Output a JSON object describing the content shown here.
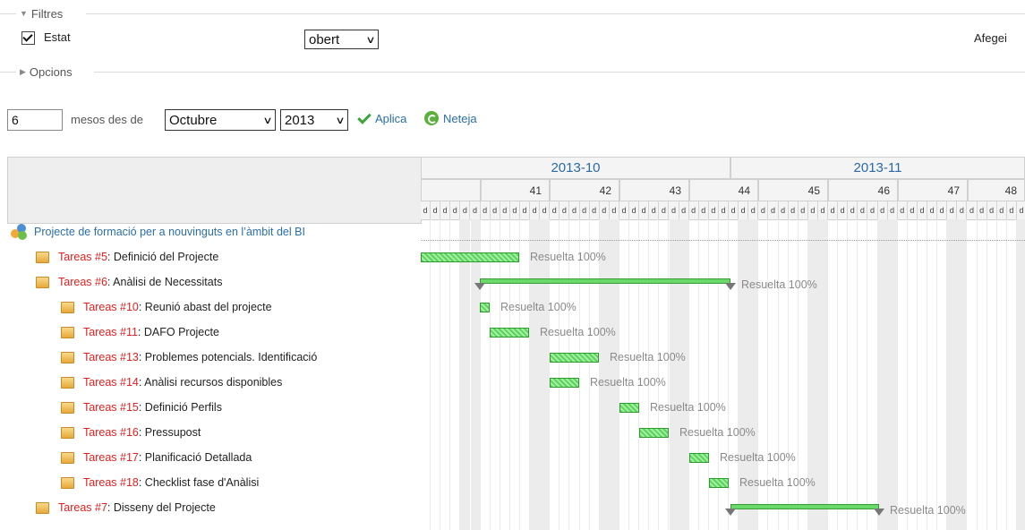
{
  "filters": {
    "legend": "Filtres",
    "estat_label": "Estat",
    "estat_value": "obert",
    "add_label": "Afegei"
  },
  "options": {
    "legend": "Opcions"
  },
  "period": {
    "months": "6",
    "mesos_label": "mesos des de",
    "month_value": "Octubre",
    "year_value": "2013",
    "apply_label": "Aplica",
    "clear_label": "Neteja"
  },
  "gantt": {
    "months": [
      "2013-10",
      "2013-11"
    ],
    "weeks": [
      "41",
      "42",
      "43",
      "44",
      "45",
      "46",
      "47",
      "48"
    ],
    "day_letter": "d",
    "rows": [
      {
        "type": "project",
        "label": "Projecte de formació per a nouvinguts en l’àmbit del BI"
      },
      {
        "type": "task",
        "level": 1,
        "link": "Tareas #5",
        "title": ": Definició del Projecte",
        "status": "Resuelta 100%"
      },
      {
        "type": "task",
        "level": 1,
        "link": "Tareas #6",
        "title": ": Anàlisi de Necessitats",
        "status": "Resuelta 100%"
      },
      {
        "type": "task",
        "level": 2,
        "link": "Tareas #10",
        "title": ": Reunió abast del projecte",
        "status": "Resuelta 100%"
      },
      {
        "type": "task",
        "level": 2,
        "link": "Tareas #11",
        "title": ": DAFO Projecte",
        "status": "Resuelta 100%"
      },
      {
        "type": "task",
        "level": 2,
        "link": "Tareas #13",
        "title": ": Problemes potencials. Identificació",
        "status": "Resuelta 100%"
      },
      {
        "type": "task",
        "level": 2,
        "link": "Tareas #14",
        "title": ": Anàlisi recursos disponibles",
        "status": "Resuelta 100%"
      },
      {
        "type": "task",
        "level": 2,
        "link": "Tareas #15",
        "title": ": Definició Perfils",
        "status": "Resuelta 100%"
      },
      {
        "type": "task",
        "level": 2,
        "link": "Tareas #16",
        "title": ": Pressupost",
        "status": "Resuelta 100%"
      },
      {
        "type": "task",
        "level": 2,
        "link": "Tareas #17",
        "title": ": Planificació Detallada",
        "status": "Resuelta 100%"
      },
      {
        "type": "task",
        "level": 2,
        "link": "Tareas #18",
        "title": ": Checklist fase d'Anàlisi",
        "status": "Resuelta 100%"
      },
      {
        "type": "task",
        "level": 1,
        "link": "Tareas #7",
        "title": ": Disseny del Projecte",
        "status": "Resuelta 100%"
      }
    ]
  },
  "colors": {
    "link_blue": "#2a6fa8",
    "task_red": "#e02020",
    "bar_green": "#5fd15f",
    "status_gray": "#8a8a8a"
  }
}
